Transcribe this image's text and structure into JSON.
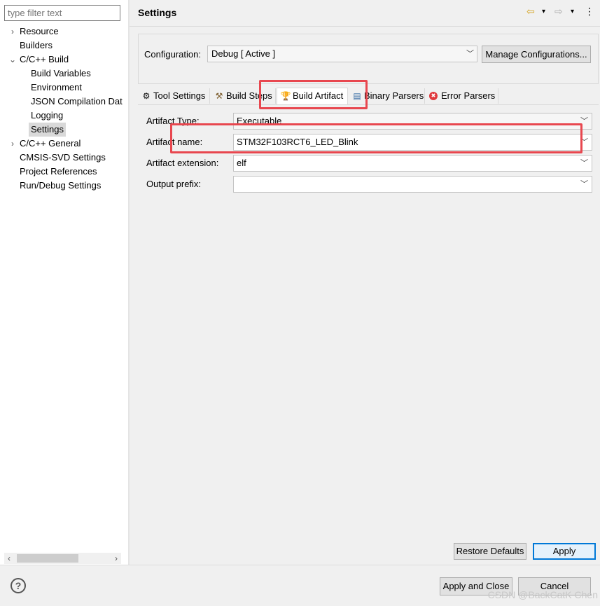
{
  "sidebar": {
    "filter_placeholder": "type filter text",
    "items": [
      {
        "label": "Resource",
        "twisty": ">"
      },
      {
        "label": "Builders",
        "twisty": ""
      },
      {
        "label": "C/C++ Build",
        "twisty": "v"
      },
      {
        "label": "Build Variables",
        "twisty": ""
      },
      {
        "label": "Environment",
        "twisty": ""
      },
      {
        "label": "JSON Compilation Dat",
        "twisty": ""
      },
      {
        "label": "Logging",
        "twisty": ""
      },
      {
        "label": "Settings",
        "twisty": ""
      },
      {
        "label": "C/C++ General",
        "twisty": ">"
      },
      {
        "label": "CMSIS-SVD Settings",
        "twisty": ""
      },
      {
        "label": "Project References",
        "twisty": ""
      },
      {
        "label": "Run/Debug Settings",
        "twisty": ""
      }
    ],
    "scroll_left": "‹",
    "scroll_right": "›"
  },
  "header": {
    "title": "Settings",
    "back_icon": "⇦",
    "forward_icon": "⇨",
    "dropdown_icon": "▾",
    "menu_icon": "⋮"
  },
  "config": {
    "label": "Configuration:",
    "value": "Debug  [ Active ]",
    "manage_button": "Manage Configurations..."
  },
  "tabs": [
    {
      "label": "Tool Settings",
      "icon": "⚙"
    },
    {
      "label": "Build Steps",
      "icon": "⚒"
    },
    {
      "label": "Build Artifact",
      "icon": "🏆"
    },
    {
      "label": "Binary Parsers",
      "icon": "▤"
    },
    {
      "label": "Error Parsers",
      "icon": "✖"
    }
  ],
  "fields": {
    "artifact_type": {
      "label": "Artifact Type:",
      "value": "Executable"
    },
    "artifact_name": {
      "label": "Artifact name:",
      "value": "STM32F103RCT6_LED_Blink"
    },
    "artifact_extension": {
      "label": "Artifact extension:",
      "value": "elf"
    },
    "output_prefix": {
      "label": "Output prefix:",
      "value": ""
    }
  },
  "buttons": {
    "restore_defaults": "Restore Defaults",
    "apply": "Apply",
    "apply_and_close": "Apply and Close",
    "cancel": "Cancel",
    "help": "?"
  },
  "watermark": "CSDN @BackCatK Chen",
  "colors": {
    "highlight": "#e8474f",
    "apply_border": "#0078d7"
  }
}
